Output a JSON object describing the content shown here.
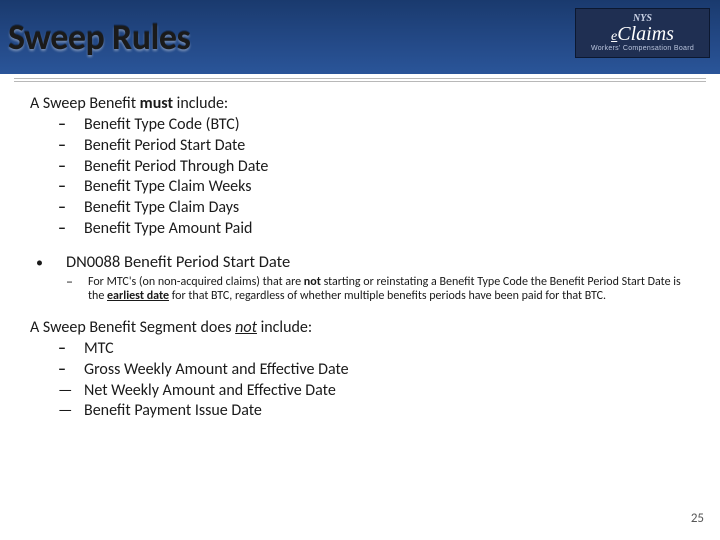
{
  "title": "Sweep Rules",
  "logo": {
    "top": "NYS",
    "mid_e": "e",
    "mid_rest": "Claims",
    "bottom": "Workers' Compensation Board"
  },
  "lead1_pre": "A Sweep Benefit ",
  "lead1_bold": "must ",
  "lead1_post": "include:",
  "must_items": [
    "Benefit Type Code (BTC)",
    "Benefit Period Start Date",
    "Benefit Period Through Date",
    "Benefit Type Claim Weeks",
    "Benefit Type Claim Days",
    "Benefit Type Amount Paid"
  ],
  "dn_label": "DN0088  Benefit Period Start Date",
  "note_parts": {
    "a": "For MTC's (on non-acquired claims) that are ",
    "b": "not",
    "c": " starting or reinstating a Benefit Type Code the Benefit Period Start Date is the ",
    "d": "earliest date",
    "e": " for that BTC, regardless of whether multiple benefits periods have been paid for that BTC."
  },
  "lead2_pre": "A Sweep Benefit Segment does ",
  "lead2_not": "not",
  "lead2_post": " include:",
  "not_items_dash": [
    "MTC",
    "Gross Weekly Amount and Effective Date"
  ],
  "not_items_em": [
    "Net Weekly Amount and Effective Date",
    "Benefit Payment Issue Date"
  ],
  "page_number": "25"
}
